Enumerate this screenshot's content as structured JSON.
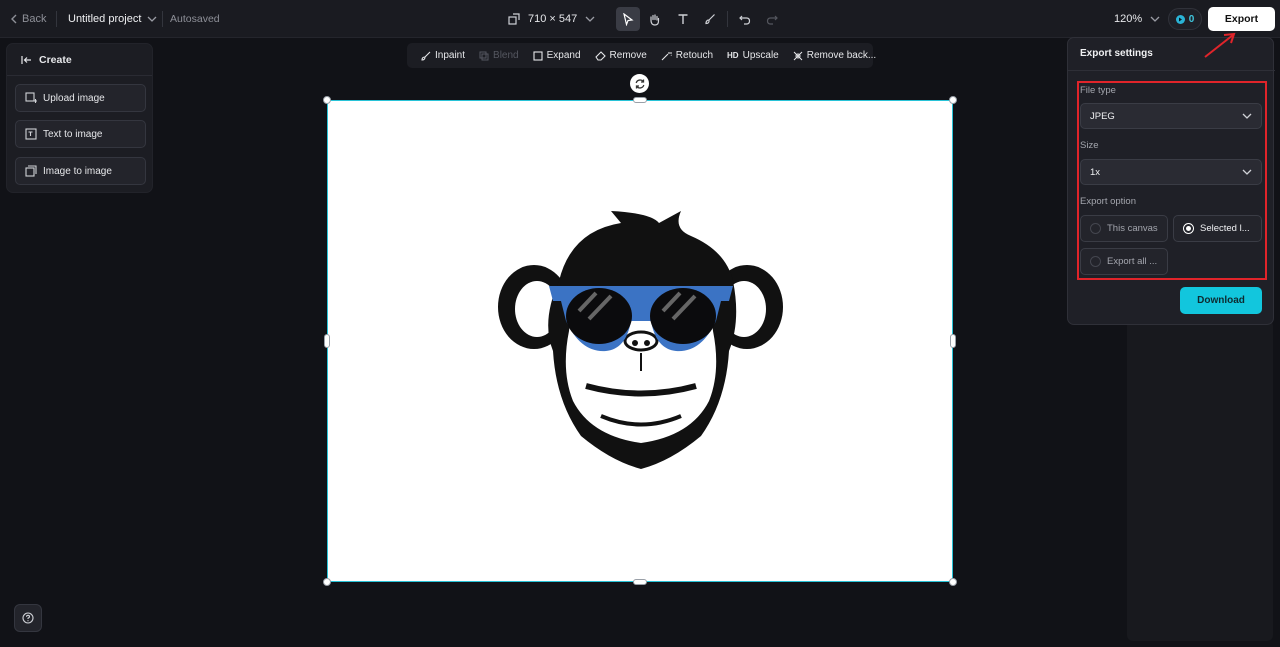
{
  "topbar": {
    "back_label": "Back",
    "project_name": "Untitled project",
    "autosave_status": "Autosaved",
    "canvas_size": "710 × 547",
    "zoom": "120%",
    "credits": "0",
    "export_label": "Export"
  },
  "create_panel": {
    "title": "Create",
    "items": [
      {
        "label": "Upload image"
      },
      {
        "label": "Text to image"
      },
      {
        "label": "Image to image"
      }
    ]
  },
  "ai_toolbar": {
    "items": [
      {
        "label": "Inpaint",
        "enabled": true
      },
      {
        "label": "Blend",
        "enabled": false
      },
      {
        "label": "Expand",
        "enabled": true
      },
      {
        "label": "Remove",
        "enabled": true
      },
      {
        "label": "Retouch",
        "enabled": true
      },
      {
        "label": "Upscale",
        "badge": "HD",
        "enabled": true
      },
      {
        "label": "Remove back...",
        "enabled": true
      }
    ]
  },
  "export_settings": {
    "title": "Export settings",
    "file_type_label": "File type",
    "file_type_value": "JPEG",
    "size_label": "Size",
    "size_value": "1x",
    "export_option_label": "Export option",
    "options": [
      {
        "label": "This canvas",
        "selected": false
      },
      {
        "label": "Selected l...",
        "selected": true
      },
      {
        "label": "Export all ...",
        "selected": false
      }
    ],
    "download_label": "Download"
  },
  "colors": {
    "accent": "#12c6dd",
    "highlight": "#e0242a",
    "selection": "#28c3d7",
    "sunglasses": "#3b73c4"
  }
}
